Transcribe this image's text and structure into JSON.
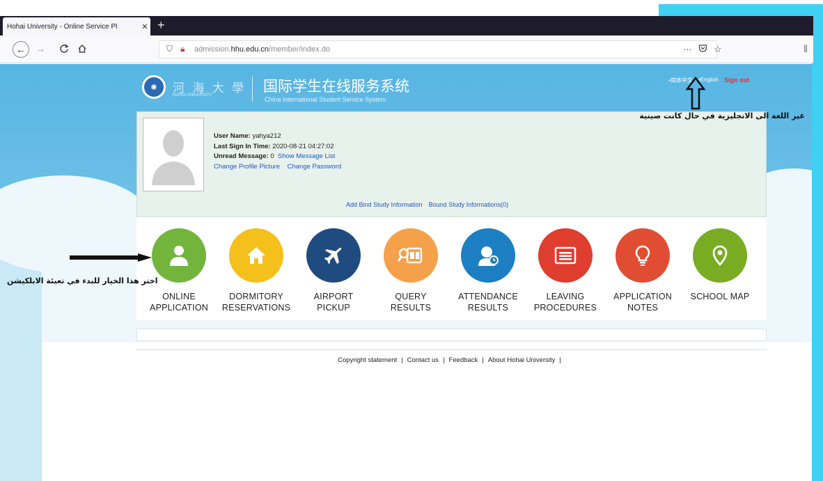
{
  "browser": {
    "tab_title": "Hohai University - Online Service Pl",
    "tab_close": "✕",
    "new_tab": "+",
    "url_prefix": "admission.",
    "url_domain": "hhu.edu.cn",
    "url_path": "/member/index.do",
    "more": "···"
  },
  "header": {
    "logo_cn": "河 海 大 學",
    "logo_en": "HOHAI UNIVERSITY",
    "system_cn": "国际学生在线服务系统",
    "system_en": "China International Student Service System",
    "lang_cn": "•简体中文",
    "lang_en": "•English",
    "sign_out": "Sign out"
  },
  "profile": {
    "user_name_label": "User Name:",
    "user_name": "yahya212",
    "last_sign_label": "Last Sign In Time:",
    "last_sign": "2020-08-21 04:27:02",
    "unread_label": "Unread Message:",
    "unread": "0",
    "show_messages": "Show Message List",
    "change_picture": "Change Profile Picture",
    "change_password": "Change Password",
    "add_bind": "Add Bind Study Information",
    "bound_study": "Bound Study Informations(0)"
  },
  "menu": {
    "items": [
      {
        "line1": "ONLINE",
        "line2": "APPLICATION",
        "icon": "user-icon",
        "color": "#73b43d"
      },
      {
        "line1": "DORMITORY",
        "line2": "RESERVATIONS",
        "icon": "home-icon",
        "color": "#f4c01b"
      },
      {
        "line1": "AIRPORT",
        "line2": "PICKUP",
        "icon": "airplane-icon",
        "color": "#1f4b80"
      },
      {
        "line1": "QUERY",
        "line2": "RESULTS",
        "icon": "query-icon",
        "color": "#f5a04a"
      },
      {
        "line1": "ATTENDANCE",
        "line2": "RESULTS",
        "icon": "attendance-icon",
        "color": "#1c7fc1"
      },
      {
        "line1": "LEAVING",
        "line2": "PROCEDURES",
        "icon": "list-icon",
        "color": "#df3d2e"
      },
      {
        "line1": "APPLICATION",
        "line2": "NOTES",
        "icon": "lightbulb-icon",
        "color": "#e14d32"
      },
      {
        "line1": "SCHOOL MAP",
        "line2": "",
        "icon": "map-pin-icon",
        "color": "#79ac23"
      }
    ]
  },
  "footer": {
    "copyright": "Copyright statement",
    "contact": "Contact us",
    "feedback": "Feedback",
    "about": "About Hohai University",
    "sep": "|"
  },
  "annotations": {
    "language_note": "غير اللغة الى الانجليزية في حال كانت صينية",
    "start_note": "اختر هذا الخيار للبدء في تعبئة الابلكيشن"
  },
  "colors": {
    "frame": "#3fd0f4",
    "header_blue": "#57b5e2",
    "sign_out_red": "#e8302c",
    "link_blue": "#1d56c4"
  }
}
